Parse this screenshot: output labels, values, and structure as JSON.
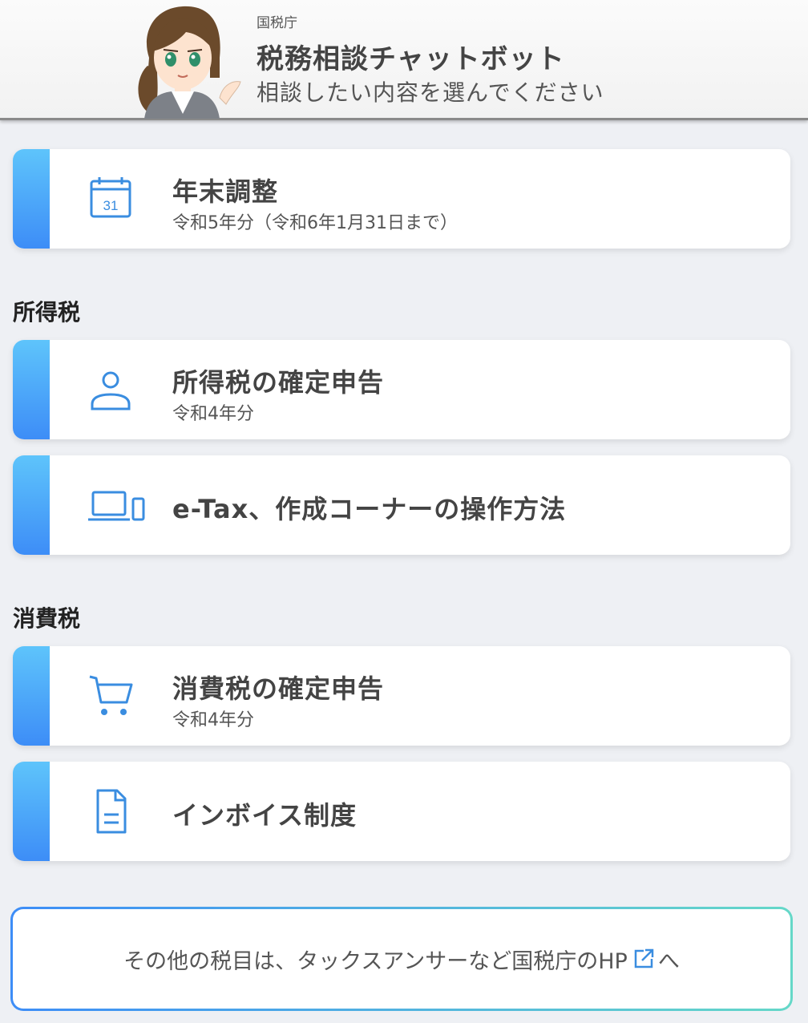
{
  "header": {
    "org": "国税庁",
    "title": "税務相談チャットボット",
    "subtitle": "相談したい内容を選んでください"
  },
  "year_end": {
    "title": "年末調整",
    "sub": "令和5年分（令和6年1月31日まで）",
    "icon": "calendar-icon",
    "icon_text": "31"
  },
  "income_tax": {
    "heading": "所得税",
    "items": [
      {
        "title": "所得税の確定申告",
        "sub": "令和4年分",
        "icon": "person-icon"
      },
      {
        "title": "e-Tax、作成コーナーの操作方法",
        "icon": "devices-icon"
      }
    ]
  },
  "consumption_tax": {
    "heading": "消費税",
    "items": [
      {
        "title": "消費税の確定申告",
        "sub": "令和4年分",
        "icon": "cart-icon"
      },
      {
        "title": "インボイス制度",
        "icon": "document-icon"
      }
    ]
  },
  "footer": {
    "text_before": "その他の税目は、タックスアンサーなど国税庁のHP",
    "text_after": "へ",
    "icon": "external-link-icon"
  },
  "colors": {
    "accent_top": "#5ec4fb",
    "accent_bottom": "#3d8df7",
    "icon": "#3a8de0",
    "footer_gradient_end": "#65d8c8",
    "background": "#eef0f4"
  }
}
